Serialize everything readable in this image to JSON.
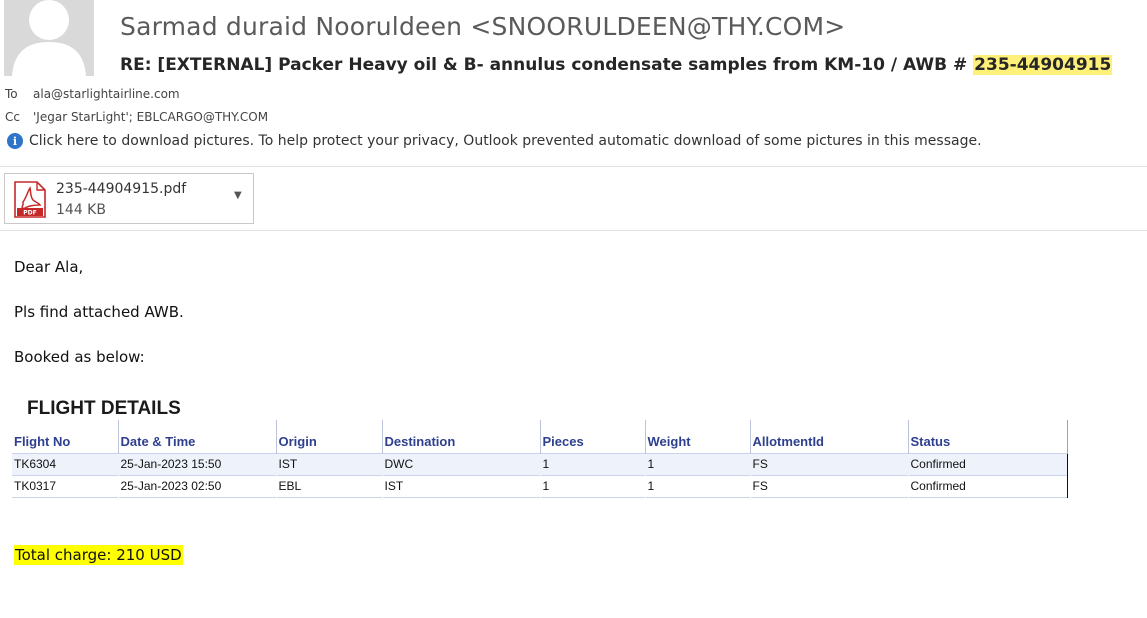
{
  "email": {
    "sender": "Sarmad duraid Nooruldeen <SNOORULDEEN@THY.COM>",
    "subject_prefix": "RE: [EXTERNAL] Packer Heavy oil & B- annulus condensate samples from KM-10 / AWB # ",
    "subject_highlight": "235-44904915",
    "to_label": "To",
    "to_value": "ala@starlightairline.com",
    "cc_label": "Cc",
    "cc_value": "'Jegar StarLight'; EBLCARGO@THY.COM",
    "info_bar": "Click here to download pictures. To help protect your privacy, Outlook prevented automatic download of some pictures in this message."
  },
  "attachment": {
    "name": "235-44904915.pdf",
    "size": "144 KB",
    "icon": "pdf-icon",
    "icon_label": "PDF"
  },
  "body": {
    "greeting": "Dear Ala,",
    "line1": "Pls find attached AWB.",
    "line2": "Booked as below:",
    "section_title": "FLIGHT DETAILS",
    "total": "Total charge: 210 USD"
  },
  "flights": {
    "columns": [
      "Flight No",
      "Date & Time",
      "Origin",
      "Destination",
      "Pieces",
      "Weight",
      "AllotmentId",
      "Status"
    ],
    "rows": [
      [
        "TK6304",
        "25-Jan-2023 15:50",
        "IST",
        "DWC",
        "1",
        "1",
        "FS",
        "Confirmed"
      ],
      [
        "TK0317",
        "25-Jan-2023 02:50",
        "EBL",
        "IST",
        "1",
        "1",
        "FS",
        "Confirmed"
      ]
    ]
  },
  "colors": {
    "subject_highlight": "#fff07a",
    "total_highlight": "#ffff00",
    "table_header_text": "#2f3f8f",
    "info_icon": "#2e74c9"
  }
}
